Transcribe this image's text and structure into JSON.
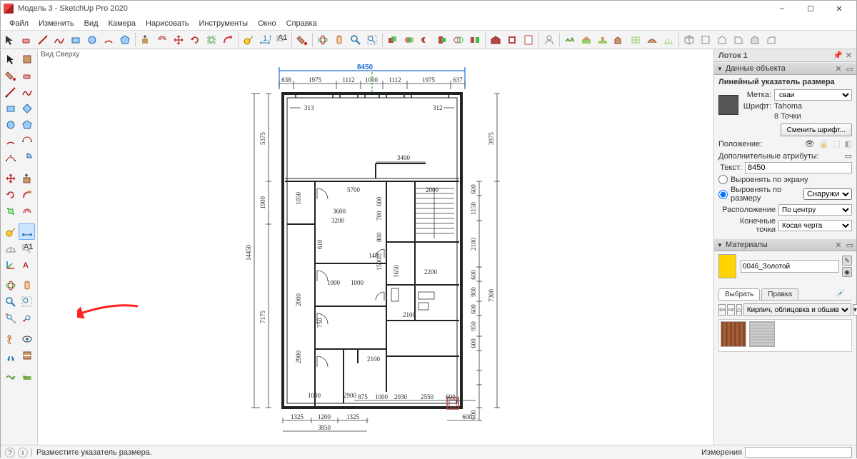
{
  "app": {
    "icon": "sketchup-icon",
    "title": "Модель 3 - SketchUp Pro 2020",
    "win_min": "–",
    "win_max": "☐",
    "win_close": "✕"
  },
  "menu": [
    "Файл",
    "Изменить",
    "Вид",
    "Камера",
    "Нарисовать",
    "Инструменты",
    "Окно",
    "Справка"
  ],
  "viewport": {
    "label": "Вид Сверху"
  },
  "tray": {
    "title": "Лоток 1",
    "panels": {
      "entity": {
        "title": "Данные объекта",
        "header": "Линейный указатель размера",
        "layer_label": "Метка:",
        "layer_value": "сваи",
        "font_label": "Шрифт:",
        "font_value": "Tahoma",
        "points": "8 Точки",
        "change_font": "Сменить шрифт...",
        "position_label": "Положение:",
        "extra_attrs": "Дополнительные атрибуты:",
        "text_label": "Текст:",
        "text_value": "8450",
        "align_screen": "Выровнять по экрану",
        "align_dim": "Выровнять по размеру",
        "outside": "Снаружи",
        "placement_label": "Расположение",
        "placement_value": "По центру",
        "endpoints_label": "Конечные точки",
        "endpoints_value": "Косая черта"
      },
      "materials": {
        "title": "Материалы",
        "name": "0046_Золотой",
        "tab_pick": "Выбрать",
        "tab_edit": "Правка",
        "category": "Кирпич, облицовка и обшив"
      }
    }
  },
  "dims": {
    "overall_w": "8450",
    "overall_h": "14450",
    "top": [
      "638",
      "1975",
      "1112",
      "1000",
      "1112",
      "1975",
      "637"
    ],
    "right_outer": [
      "3975",
      "7300"
    ],
    "right_inner": [
      "600",
      "1150",
      "2100",
      "600",
      "900",
      "600",
      "950",
      "600",
      "600"
    ],
    "left_inner": [
      "5375",
      "1900",
      "7175"
    ],
    "bottom": [
      "1325",
      "1200",
      "1325"
    ],
    "bottom_total": "3850",
    "bottom_right": [
      "875",
      "1000",
      "2030",
      "2550",
      "600",
      "600"
    ],
    "in313": "313",
    "in312": "312",
    "in3400": "3400",
    "in5700": "5700",
    "in2000r": "2000",
    "in1050": "1050",
    "in3600": "3600",
    "in3200": "3200",
    "in1480": "1480",
    "in2100": "2100",
    "in2200": "2200",
    "in1650": "1650",
    "in2900": "2900",
    "in2000l": "2000",
    "in2900b": "2900",
    "in1000a": "1000",
    "in1000b": "1000",
    "in1000c": "1000",
    "in1500": "1500",
    "in610": "610",
    "in600r": "600",
    "in700": "700",
    "in800": "800",
    "in750": "750",
    "in2100b": "2100"
  },
  "status": {
    "prompt": "Разместите указатель размера.",
    "meas_label": "Измерения",
    "meas_value": ""
  }
}
